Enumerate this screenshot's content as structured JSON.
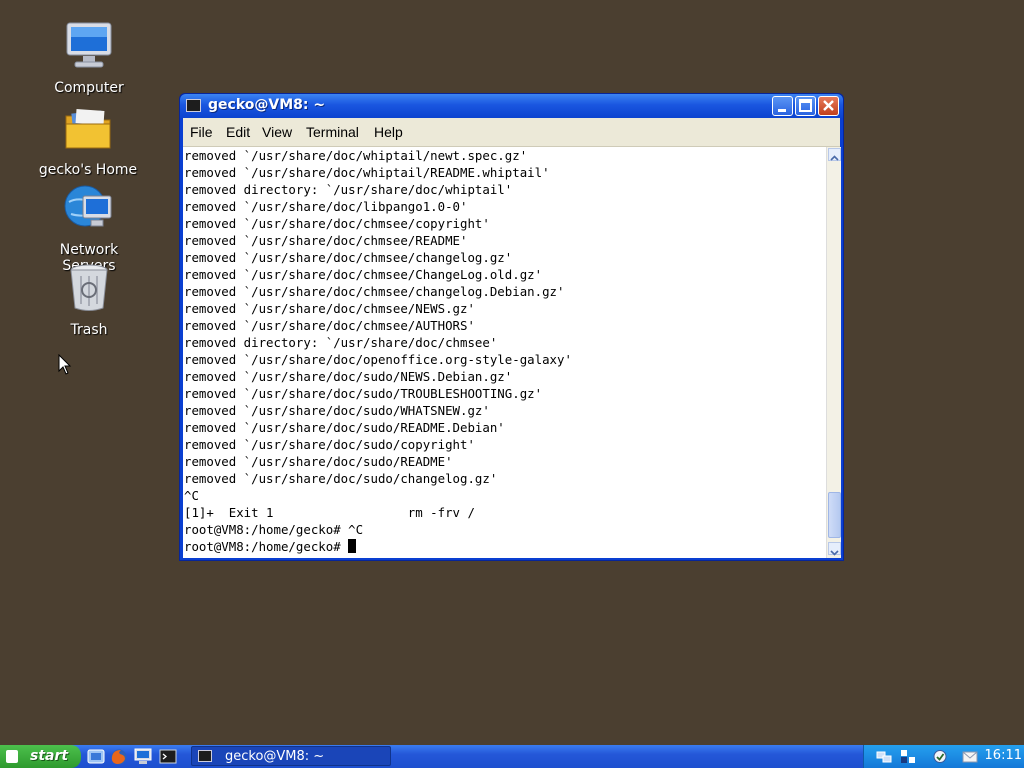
{
  "desktop": {
    "icons": [
      {
        "label": "Computer",
        "icon": "computer-icon"
      },
      {
        "label": "gecko's Home",
        "icon": "home-folder-icon"
      },
      {
        "label": "Network Servers",
        "icon": "network-servers-icon"
      },
      {
        "label": "Trash",
        "icon": "trash-icon"
      }
    ]
  },
  "window": {
    "title": "gecko@VM8: ~",
    "menu": [
      "File",
      "Edit",
      "View",
      "Terminal",
      "Help"
    ],
    "buttons": [
      "minimize-icon",
      "maximize-icon",
      "close-icon"
    ]
  },
  "terminal": {
    "lines": [
      "removed `/usr/share/doc/whiptail/newt.spec.gz'",
      "removed `/usr/share/doc/whiptail/README.whiptail'",
      "removed directory: `/usr/share/doc/whiptail'",
      "removed `/usr/share/doc/libpango1.0-0'",
      "removed `/usr/share/doc/chmsee/copyright'",
      "removed `/usr/share/doc/chmsee/README'",
      "removed `/usr/share/doc/chmsee/changelog.gz'",
      "removed `/usr/share/doc/chmsee/ChangeLog.old.gz'",
      "removed `/usr/share/doc/chmsee/changelog.Debian.gz'",
      "removed `/usr/share/doc/chmsee/NEWS.gz'",
      "removed `/usr/share/doc/chmsee/AUTHORS'",
      "removed directory: `/usr/share/doc/chmsee'",
      "removed `/usr/share/doc/openoffice.org-style-galaxy'",
      "removed `/usr/share/doc/sudo/NEWS.Debian.gz'",
      "removed `/usr/share/doc/sudo/TROUBLESHOOTING.gz'",
      "removed `/usr/share/doc/sudo/WHATSNEW.gz'",
      "removed `/usr/share/doc/sudo/README.Debian'",
      "removed `/usr/share/doc/sudo/copyright'",
      "removed `/usr/share/doc/sudo/README'",
      "removed `/usr/share/doc/sudo/changelog.gz'",
      "^C",
      "[1]+  Exit 1                  rm -frv /",
      "root@VM8:/home/gecko# ^C"
    ],
    "prompt": "root@VM8:/home/gecko# "
  },
  "taskbar": {
    "start_label": "start",
    "quick_launch": [
      "show-desktop-icon",
      "firefox-icon",
      "computer-icon",
      "terminal-icon"
    ],
    "task_button_label": "gecko@VM8: ~",
    "tray_icons": [
      "network-icon",
      "keyboard-layout-icon",
      "update-icon",
      "mail-icon"
    ],
    "clock": "16:11"
  }
}
